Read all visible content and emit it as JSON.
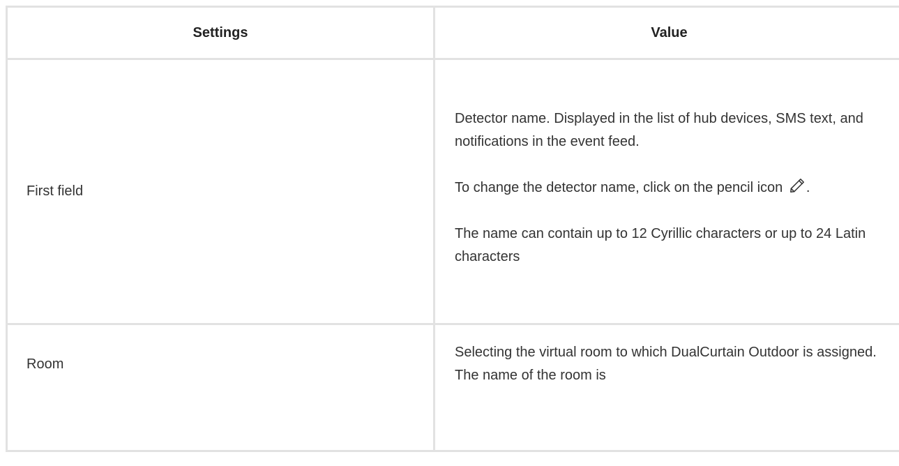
{
  "table": {
    "headers": {
      "settings": "Settings",
      "value": "Value"
    },
    "rows": [
      {
        "setting": "First field",
        "value_paragraphs": [
          "Detector name. Displayed in the list of hub devices, SMS text, and notifications in the event feed.",
          "To change the detector name, click on the pencil icon",
          "The name can contain up to 12 Cyrillic characters or up to 24 Latin characters"
        ],
        "after_icon": "."
      },
      {
        "setting": "Room",
        "value_paragraphs": [
          "Selecting the virtual room to which DualCurtain Outdoor is assigned. The name of the room is"
        ]
      }
    ]
  },
  "icons": {
    "pencil": "pencil-icon"
  }
}
